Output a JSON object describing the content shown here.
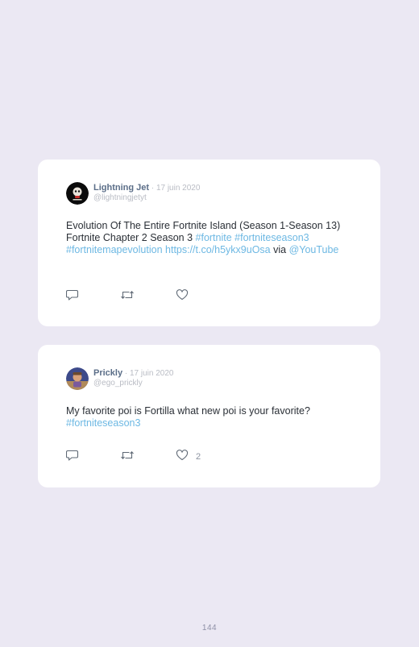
{
  "tweets": [
    {
      "display_name": "Lightning Jet",
      "separator": " · ",
      "date": "17 juin 2020",
      "handle": "@lightningjetyt",
      "text_plain_1": "Evolution Of The Entire Fortnite Island (Season 1-Season 13) Fortnite Chapter 2 Season 3 ",
      "link_1": "#fortnite",
      "space_1": " ",
      "link_2": "#fortniteseason3",
      "space_2": " ",
      "link_3": "#fortnitemapevolution",
      "space_3": " ",
      "link_4": "https://t.co/h5ykx9uOsa",
      "text_plain_2": " via ",
      "link_5": "@YouTube",
      "likes": ""
    },
    {
      "display_name": "Prickly",
      "separator": " · ",
      "date": "17 juin 2020",
      "handle": "@ego_prickly",
      "text_plain_1": "My favorite poi is Fortilla what new poi is your favorite? ",
      "link_1": "#fortniteseason3",
      "likes": "2"
    }
  ],
  "icons": {
    "reply": "reply-icon",
    "retweet": "retweet-icon",
    "like": "heart-icon"
  },
  "colors": {
    "background": "#ebe8f3",
    "card": "#ffffff",
    "link": "#6db8e3",
    "name": "#5b6e88",
    "muted": "#b9bcc4"
  },
  "page": {
    "number": "144"
  }
}
